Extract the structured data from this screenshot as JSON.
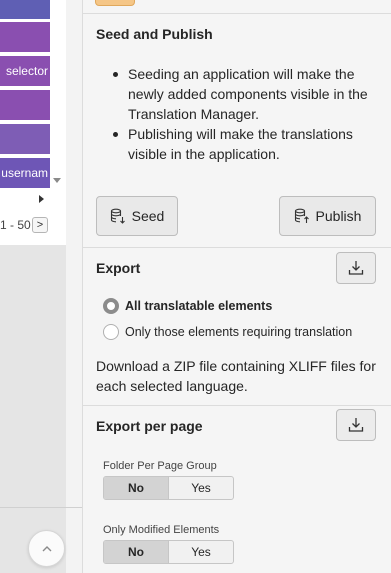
{
  "grid": {
    "cells": [
      "",
      "",
      "selector",
      "",
      "",
      "r usernam"
    ],
    "pager_text": "1 - 50",
    "pager_next": ">"
  },
  "seed_publish": {
    "title": "Seed and Publish",
    "bullets": [
      "Seeding an application will make the newly added components visible in the Translation Manager.",
      "Publishing will make the translations visible in the application."
    ],
    "seed_label": "Seed",
    "publish_label": "Publish"
  },
  "export": {
    "title": "Export",
    "options": [
      {
        "label": "All translatable elements",
        "checked": true
      },
      {
        "label": "Only those elements requiring translation",
        "checked": false
      }
    ],
    "description": "Download a ZIP file containing XLIFF files for each selected language."
  },
  "export_per_page": {
    "title": "Export per page",
    "folder_label": "Folder Per Page Group",
    "folder_options": [
      "No",
      "Yes"
    ],
    "folder_selected": "No",
    "modified_label": "Only Modified Elements",
    "modified_options": [
      "No",
      "Yes"
    ],
    "modified_selected": "No"
  },
  "icons": {
    "seed": "database-down-icon",
    "publish": "database-up-icon",
    "download": "download-icon",
    "scroll_top": "chevron-up-icon"
  }
}
